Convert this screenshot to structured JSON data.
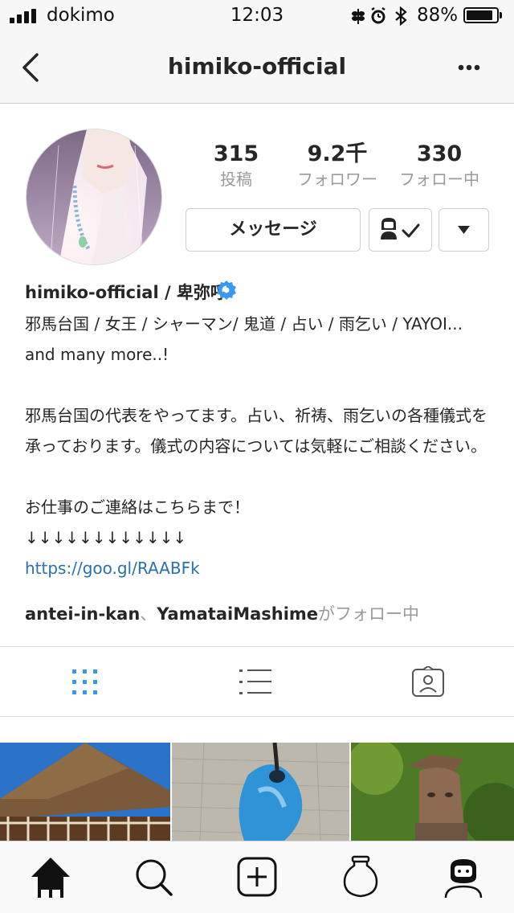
{
  "status_bar": {
    "carrier": "dokimo",
    "time": "12:03",
    "battery_percent": "88%",
    "battery_level": 0.88,
    "icons": [
      "signal-icon",
      "rice-icon",
      "alarm-icon",
      "bluetooth-icon",
      "battery-icon"
    ]
  },
  "nav": {
    "title": "himiko-official",
    "back_icon": "chevron-left-icon",
    "more_icon": "ellipsis-icon"
  },
  "profile": {
    "stats": [
      {
        "value": "315",
        "label": "投稿"
      },
      {
        "value": "9.2千",
        "label": "フォロワー"
      },
      {
        "value": "330",
        "label": "フォロー中"
      }
    ],
    "message_label": "メッセージ",
    "follow_icon": "following-check-icon",
    "dropdown_icon": "triangle-down-icon",
    "display_name": "himiko-official / 卑弥呼",
    "verified_icon": "verified-badge-icon"
  },
  "bio": {
    "line1": "邪馬台国 / 女王 / シャーマン/ 鬼道 / 占い / 雨乞い / YAYOI...",
    "line2": "and many more..!",
    "line3": "邪馬台国の代表をやってます。占い、祈祷、雨乞いの各種儀式を",
    "line4": "承っております。儀式の内容については気軽にご相談ください。",
    "line5": "お仕事のご連絡はこちらまで！",
    "line6": "↓↓↓↓↓↓↓↓↓↓↓↓",
    "link": "https://goo.gl/RAABFk"
  },
  "followed_by": {
    "user1": "antei-in-kan",
    "separator": "、",
    "user2": "YamataiMashime",
    "suffix": "がフォロー中"
  },
  "tabs": {
    "items": [
      "grid-icon",
      "list-icon",
      "tagged-icon"
    ],
    "active": "grid-icon",
    "accent": "#3897f0"
  },
  "posts": [
    {
      "subject": "watchtower"
    },
    {
      "subject": "turquoise magatama"
    },
    {
      "subject": "haniwa figure"
    }
  ],
  "bottom_tabs": {
    "items": [
      "house-icon",
      "search-icon",
      "add-icon",
      "jar-icon",
      "profile-icon"
    ]
  }
}
